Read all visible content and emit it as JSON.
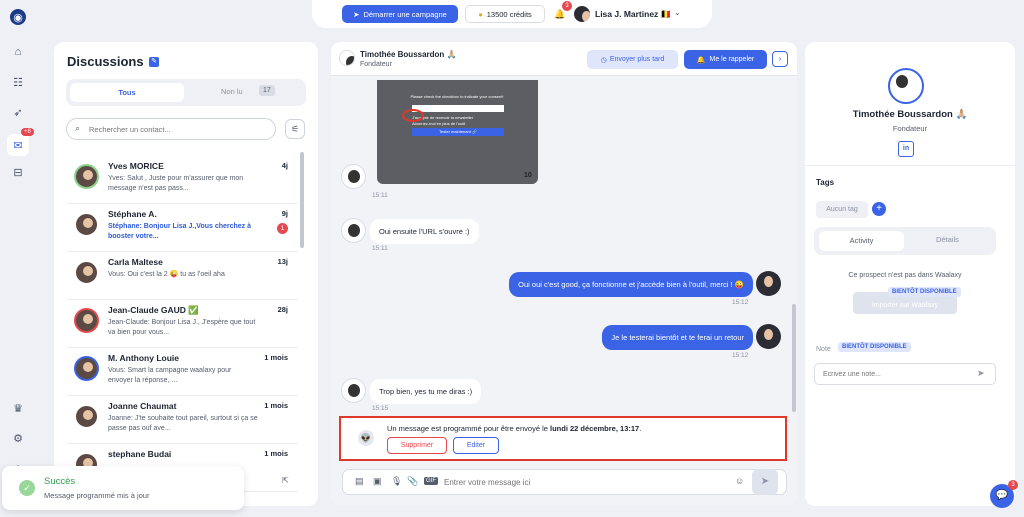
{
  "topbar": {
    "campaign_label": "Démarrer une campagne",
    "credits_label": "13500 crédits",
    "notif_count": "3",
    "user_name": "Lisa J. Martinez 🇧🇪"
  },
  "rail": {
    "badge": "+8"
  },
  "discussions": {
    "title": "Discussions",
    "tab_all": "Tous",
    "tab_unread": "Non lu",
    "tab_unread_count": "17",
    "search_placeholder": "Rechercher un contact...",
    "items": [
      {
        "name": "Yves MORICE",
        "time": "4j",
        "preview": "Yves: Salut , Juste pour m'assurer que mon message n'est pas pass...",
        "unread": false
      },
      {
        "name": "Stéphane A.",
        "time": "9j",
        "preview": "Stéphane: Bonjour Lisa J.,Vous cherchez à booster votre...",
        "unread": true,
        "badge": "1"
      },
      {
        "name": "Carla Maltese",
        "time": "13j",
        "preview": "Vous: Oui c'est la 2 😜 tu as l'oeil aha",
        "unread": false
      },
      {
        "name": "Jean-Claude GAUD ✅",
        "time": "28j",
        "preview": "Jean-Claude: Bonjour Lisa J., J'espère que tout va bien pour vous...",
        "unread": false
      },
      {
        "name": "M. Anthony Louie",
        "time": "1 mois",
        "preview": "Vous: Smart la campagne waalaxy pour envoyer la réponse, ...",
        "unread": false
      },
      {
        "name": "Joanne Chaumat",
        "time": "1 mois",
        "preview": "Joanne: J'te souhaite tout pareil, surtout si ça se passe pas ouf ave...",
        "unread": false
      },
      {
        "name": "stephane Budai",
        "time": "1 mois",
        "preview": "",
        "unread": false
      }
    ]
  },
  "toast": {
    "title": "Succès",
    "message": "Message programmé mis à jour"
  },
  "chat": {
    "contact_name": "Timothée Boussardon 🙏🏼",
    "contact_role": "Fondateur",
    "send_later": "Envoyer plus tard",
    "remind_me": "Me le rappeler",
    "screenshot_text": {
      "line1": "Please check the checkbox to indicate your consent!",
      "line2": "J'accepte de recevoir la newsletter",
      "line3": "Abonnez-moi en plus de l'outil",
      "button": "Tester maintenant 🔗",
      "corner": "10"
    },
    "messages": [
      {
        "dir": "in",
        "text": "",
        "time": "15:11"
      },
      {
        "dir": "in",
        "text": "Oui ensuite l'URL s'ouvre :)",
        "time": "15:11"
      },
      {
        "dir": "out",
        "text": "Oui oui c'est good, ça fonctionne et j'accède bien à l'outil, merci ! 😜",
        "time": "15:12"
      },
      {
        "dir": "out",
        "text": "Je le testerai bientôt et te ferai un retour",
        "time": "15:12"
      },
      {
        "dir": "in",
        "text": "Trop bien, yes tu me diras :)",
        "time": "15:15"
      }
    ],
    "scheduled": {
      "prefix": "Un message est programmé pour être envoyé le ",
      "date": "lundi 22 décembre, 13:17",
      "suffix": ".",
      "delete": "Supprimer",
      "edit": "Editer"
    },
    "input_placeholder": "Entrer votre message ici",
    "gif_label": "GIF"
  },
  "profile": {
    "name": "Timothée Boussardon 🙏🏼",
    "role": "Fondateur",
    "linkedin": "in",
    "tags_title": "Tags",
    "no_tag": "Aucun tag",
    "tab_activity": "Activity",
    "tab_details": "Détails",
    "not_in_waalaxy": "Ce prospect n'est pas dans Waalaxy",
    "available_soon": "BIENTÔT DISPONIBLE",
    "import_label": "Importer sur Waalaxy",
    "note_label": "Note",
    "note_placeholder": "Écrivez une note..."
  },
  "help": {
    "badge": "3"
  }
}
